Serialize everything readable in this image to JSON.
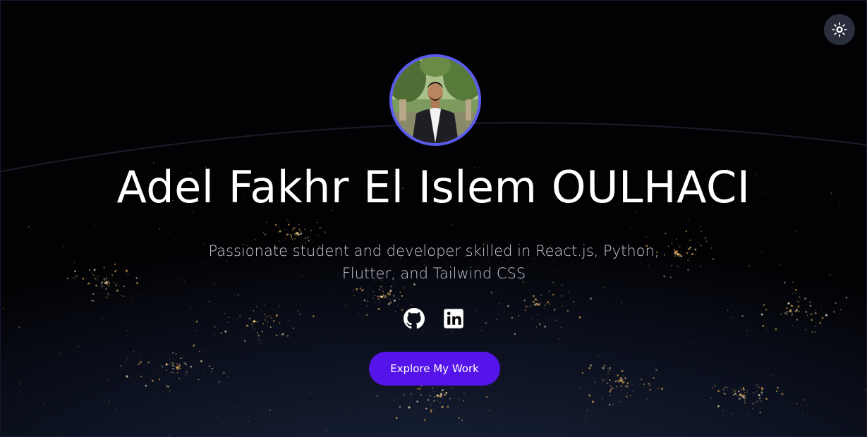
{
  "header": {
    "theme_toggle_icon": "sun-icon"
  },
  "hero": {
    "avatar_alt": "profile photo",
    "name": "Adel Fakhr El Islem OULHACI",
    "tagline": "Passionate student and developer skilled in React.js, Python, Flutter, and Tailwind CSS",
    "socials": [
      {
        "icon": "github-icon"
      },
      {
        "icon": "linkedin-icon"
      }
    ],
    "cta_label": "Explore My Work"
  },
  "colors": {
    "accent": "#5414ea",
    "avatar_ring": "#5b5bf0",
    "toggle_bg": "#2b2f3d",
    "text_primary": "#ffffff",
    "text_secondary": "#c8c8d2"
  }
}
